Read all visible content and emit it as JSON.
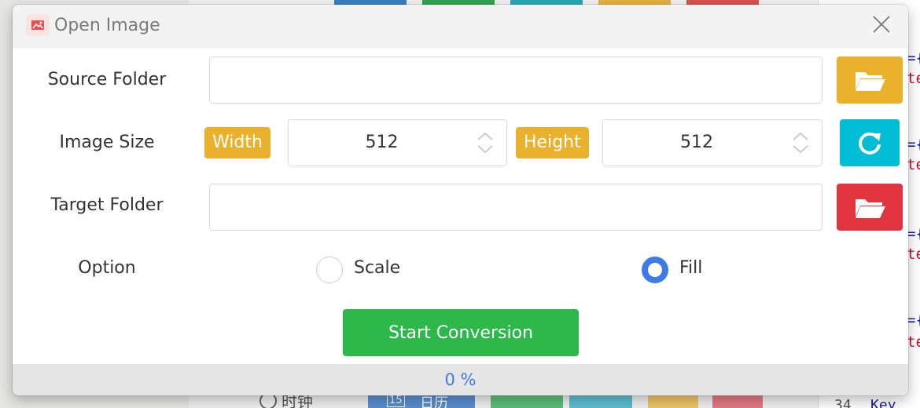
{
  "window": {
    "title": "Open Image",
    "app_icon": "image-icon",
    "close_icon": "close-icon"
  },
  "source_folder": {
    "label": "Source Folder",
    "value": "",
    "button_icon": "folder-open-icon",
    "button_color": "#e9b12c"
  },
  "image_size": {
    "label": "Image Size",
    "width_tag": "Width",
    "width_value": "512",
    "height_tag": "Height",
    "height_value": "512",
    "reset_icon": "refresh-icon",
    "reset_color": "#00bcd4"
  },
  "target_folder": {
    "label": "Target Folder",
    "value": "",
    "button_icon": "folder-open-icon",
    "button_color": "#e0353e"
  },
  "option": {
    "label": "Option",
    "choices": [
      {
        "label": "Scale",
        "selected": false
      },
      {
        "label": "Fill",
        "selected": true
      }
    ]
  },
  "start_button": {
    "label": "Start Conversion",
    "color": "#2eb84b"
  },
  "progress": {
    "value": 0,
    "text": "0 %"
  },
  "background": {
    "clock_label": "时钟",
    "calendar_day": "15",
    "calendar_label": "日历",
    "code_tokens": [
      "={",
      "te",
      "={",
      "te",
      "={",
      "te",
      "={",
      "te"
    ],
    "line_number": "34",
    "code_key": "Key"
  },
  "colors": {
    "accent": "#3f7be8",
    "tag": "#e9b12c"
  }
}
